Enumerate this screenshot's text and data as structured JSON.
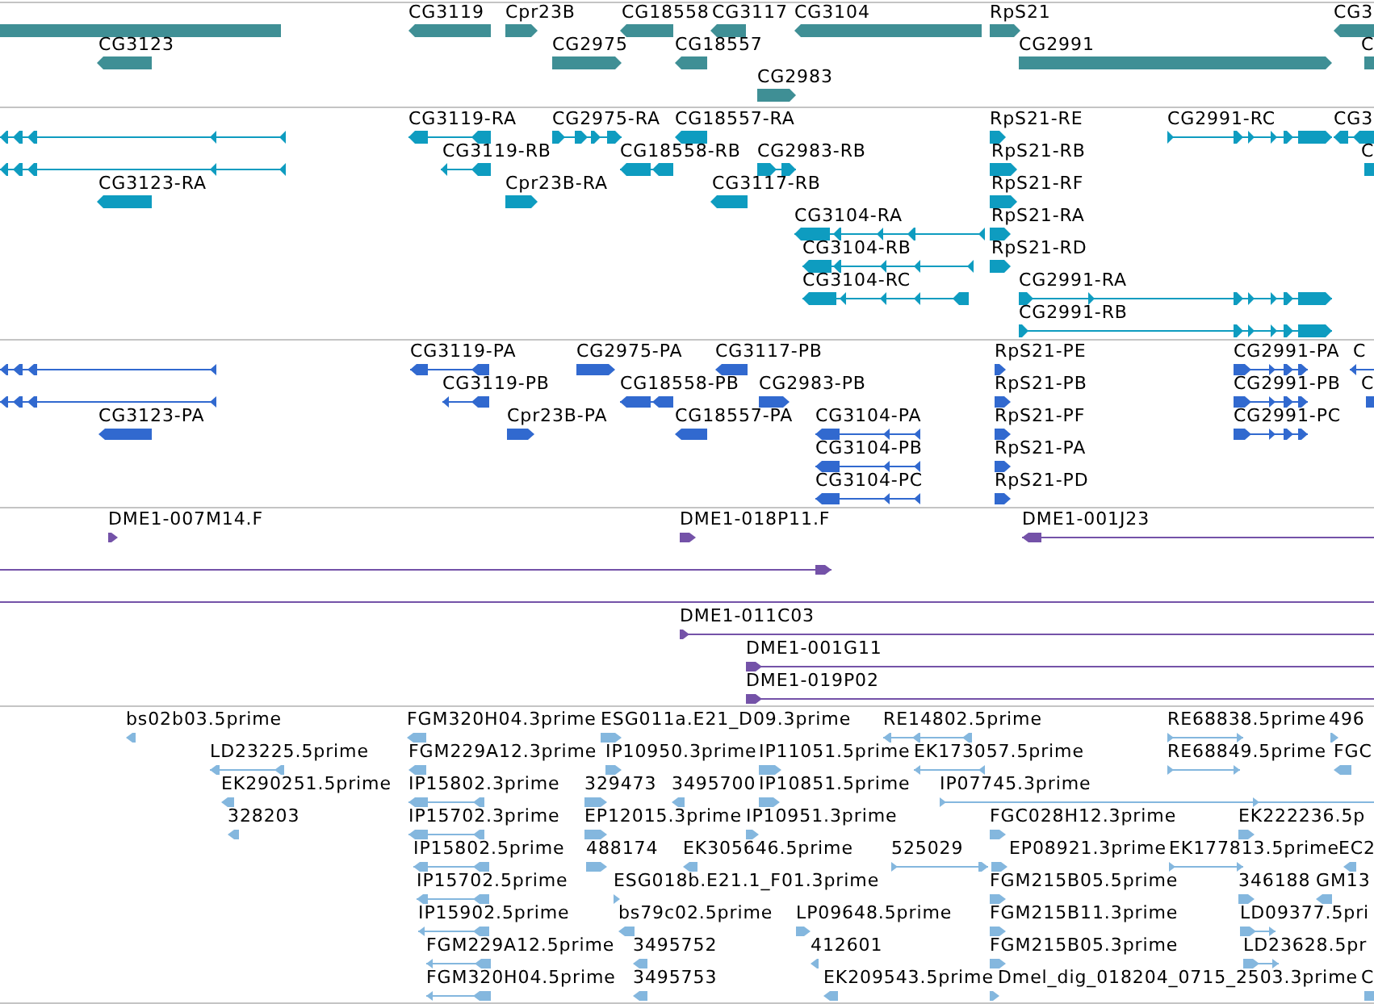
{
  "tracks": [
    {
      "kind": "genes",
      "features": [
        {
          "reverse": true
        },
        {
          "label": "CG3119",
          "reverse": true
        },
        {
          "label": "Cpr23B",
          "reverse": false
        },
        {
          "label": "CG18558",
          "reverse": true
        },
        {
          "label": "CG3117",
          "reverse": true
        },
        {
          "label": "CG3104",
          "reverse": true
        },
        {
          "label": "RpS21",
          "reverse": false
        },
        {
          "label": "CG3",
          "reverse": true
        },
        {
          "label": "CG3123",
          "reverse": true
        },
        {
          "label": "CG2975",
          "reverse": false
        },
        {
          "label": "CG18557",
          "reverse": true
        },
        {
          "label": "CG2991",
          "reverse": false
        },
        {
          "label": "C",
          "reverse": false
        },
        {
          "label": "CG2983",
          "reverse": false
        }
      ]
    },
    {
      "kind": "transcripts",
      "features": [
        {
          "reverse": true
        },
        {
          "label": "CG3119-RA",
          "reverse": true
        },
        {
          "label": "CG2975-RA",
          "reverse": false
        },
        {
          "label": "CG18557-RA",
          "reverse": true
        },
        {
          "label": "RpS21-RE",
          "reverse": false
        },
        {
          "label": "CG2991-RC",
          "reverse": false
        },
        {
          "label": "CG3",
          "reverse": true
        },
        {
          "reverse": true
        },
        {
          "label": "CG3119-RB",
          "reverse": true
        },
        {
          "label": "CG18558-RB",
          "reverse": true
        },
        {
          "label": "CG2983-RB",
          "reverse": false
        },
        {
          "label": "RpS21-RB",
          "reverse": false
        },
        {
          "label": "C",
          "reverse": false
        },
        {
          "label": "CG3123-RA",
          "reverse": true
        },
        {
          "label": "Cpr23B-RA",
          "reverse": false
        },
        {
          "label": "CG3117-RB",
          "reverse": true
        },
        {
          "label": "RpS21-RF",
          "reverse": false
        },
        {
          "label": "CG3104-RA",
          "reverse": true
        },
        {
          "label": "RpS21-RA",
          "reverse": false
        },
        {
          "label": "CG3104-RB",
          "reverse": true
        },
        {
          "label": "RpS21-RD",
          "reverse": false
        },
        {
          "label": "CG3104-RC",
          "reverse": true
        },
        {
          "label": "CG2991-RA",
          "reverse": false
        },
        {
          "label": "CG2991-RB",
          "reverse": false
        }
      ]
    },
    {
      "kind": "proteins",
      "features": [
        {
          "reverse": true
        },
        {
          "label": "CG3119-PA",
          "reverse": true
        },
        {
          "label": "CG2975-PA",
          "reverse": false
        },
        {
          "label": "CG3117-PB",
          "reverse": true
        },
        {
          "label": "RpS21-PE",
          "reverse": false
        },
        {
          "label": "CG2991-PA",
          "reverse": false
        },
        {
          "label": "C",
          "reverse": true
        },
        {
          "reverse": true
        },
        {
          "label": "CG3119-PB",
          "reverse": true
        },
        {
          "label": "CG18558-PB",
          "reverse": true
        },
        {
          "label": "CG2983-PB",
          "reverse": false
        },
        {
          "label": "RpS21-PB",
          "reverse": false
        },
        {
          "label": "CG2991-PB",
          "reverse": false
        },
        {
          "label": "C",
          "reverse": false
        },
        {
          "label": "CG3123-PA",
          "reverse": true
        },
        {
          "label": "Cpr23B-PA",
          "reverse": false
        },
        {
          "label": "CG18557-PA",
          "reverse": true
        },
        {
          "label": "CG3104-PA",
          "reverse": true
        },
        {
          "label": "RpS21-PF",
          "reverse": false
        },
        {
          "label": "CG2991-PC",
          "reverse": false
        },
        {
          "label": "CG3104-PB",
          "reverse": true
        },
        {
          "label": "RpS21-PA",
          "reverse": false
        },
        {
          "label": "CG3104-PC",
          "reverse": true
        },
        {
          "label": "RpS21-PD",
          "reverse": false
        }
      ]
    },
    {
      "kind": "clones",
      "features": [
        {
          "kind": "block",
          "label": "DME1-007M14.F",
          "reverse": false
        },
        {
          "kind": "block",
          "label": "DME1-018P11.F",
          "reverse": false
        },
        {
          "kind": "span",
          "label": "DME1-001J23",
          "reverse": true
        },
        {
          "kind": "span",
          "reverse": false
        },
        {
          "kind": "line"
        },
        {
          "kind": "span",
          "label": "DME1-011C03",
          "reverse": false
        },
        {
          "kind": "span",
          "label": "DME1-001G11",
          "reverse": false
        },
        {
          "kind": "span",
          "label": "DME1-019P02",
          "reverse": false
        }
      ]
    },
    {
      "kind": "ests",
      "features": [
        {
          "label": "bs02b03.5prime",
          "reverse": true
        },
        {
          "label": "FGM320H04.3prime",
          "reverse": true
        },
        {
          "label": "ESG011a.E21_D09.3prime",
          "reverse": false
        },
        {
          "label": "RE14802.5prime",
          "reverse": true
        },
        {
          "label": "RE68838.5prime",
          "reverse": false
        },
        {
          "label": "496",
          "reverse": false
        },
        {
          "label": "LD23225.5prime",
          "reverse": true
        },
        {
          "label": "FGM229A12.3prime",
          "reverse": true
        },
        {
          "label": "IP10950.3prime",
          "reverse": false
        },
        {
          "label": "IP11051.5prime",
          "reverse": false
        },
        {
          "label": "EK173057.5prime",
          "reverse": true
        },
        {
          "label": "RE68849.5prime",
          "reverse": false
        },
        {
          "label": "FGC",
          "reverse": true
        },
        {
          "label": "EK290251.5prime",
          "reverse": true
        },
        {
          "label": "IP15802.3prime",
          "reverse": true
        },
        {
          "label": "329473",
          "reverse": false
        },
        {
          "label": "3495700",
          "reverse": true
        },
        {
          "label": "IP10851.5prime",
          "reverse": false
        },
        {
          "label": "IP07745.3prime",
          "reverse": false
        },
        {
          "label": "328203",
          "reverse": true
        },
        {
          "label": "IP15702.3prime",
          "reverse": true
        },
        {
          "label": "EP12015.3prime",
          "reverse": false
        },
        {
          "label": "IP10951.3prime",
          "reverse": false
        },
        {
          "label": "FGC028H12.3prime",
          "reverse": false
        },
        {
          "label": "EK222236.5p",
          "reverse": false
        },
        {
          "label": "IP15802.5prime",
          "reverse": true
        },
        {
          "label": "488174",
          "reverse": false
        },
        {
          "label": "EK305646.5prime",
          "reverse": true
        },
        {
          "label": "525029",
          "reverse": false
        },
        {
          "label": "EP08921.3prime",
          "reverse": false
        },
        {
          "label": "EK177813.5prime",
          "reverse": false
        },
        {
          "label": "EC2",
          "reverse": true
        },
        {
          "label": "IP15702.5prime",
          "reverse": true
        },
        {
          "label": "ESG018b.E21.1_F01.3prime",
          "reverse": false
        },
        {
          "label": "FGM215B05.5prime",
          "reverse": false
        },
        {
          "label": "346188",
          "reverse": false
        },
        {
          "label": "GM13",
          "reverse": true
        },
        {
          "label": "IP15902.5prime",
          "reverse": true
        },
        {
          "label": "bs79c02.5prime",
          "reverse": true
        },
        {
          "label": "LP09648.5prime",
          "reverse": false
        },
        {
          "label": "FGM215B11.3prime",
          "reverse": false
        },
        {
          "label": "LD09377.5pri",
          "reverse": false
        },
        {
          "label": "FGM229A12.5prime",
          "reverse": true
        },
        {
          "label": "3495752",
          "reverse": true
        },
        {
          "label": "412601",
          "reverse": true
        },
        {
          "label": "FGM215B05.3prime",
          "reverse": false
        },
        {
          "label": "LD23628.5pr",
          "reverse": false
        },
        {
          "label": "FGM320H04.5prime",
          "reverse": true
        },
        {
          "label": "3495753",
          "reverse": true
        },
        {
          "label": "EK209543.5prime",
          "reverse": true
        },
        {
          "label": "Dmel_dig_018204_0715_2503.3prime",
          "reverse": false
        },
        {
          "label": "C",
          "reverse": false
        }
      ]
    }
  ]
}
